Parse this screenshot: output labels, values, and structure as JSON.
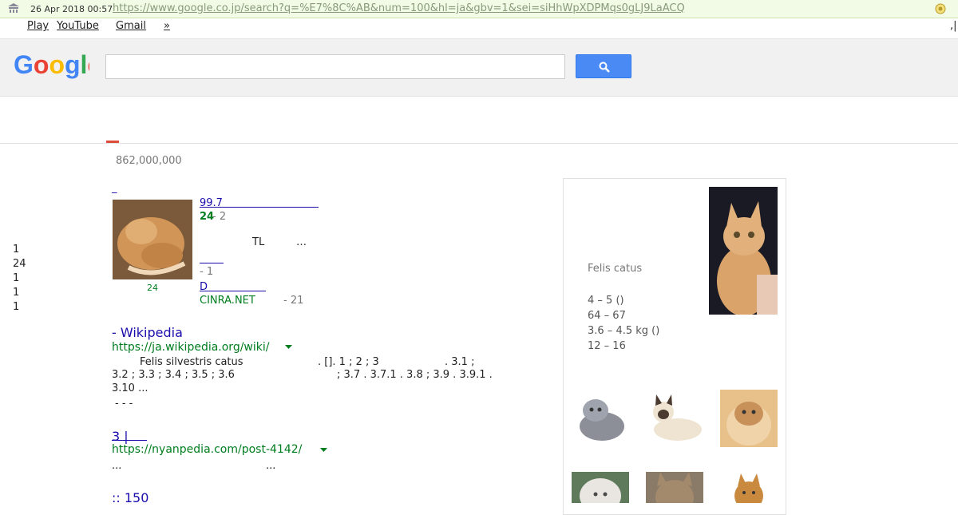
{
  "archive": {
    "date": "26 Apr 2018 00:57",
    "url": "https://www.google.co.jp/search?q=%E7%8C%AB&num=100&hl=ja&gbv=1&sei=siHhWpXDPMqs0gLJ9LaACQ",
    "right_mark": ",|"
  },
  "nav": {
    "play": "Play",
    "youtube": "YouTube",
    "gmail": "Gmail",
    "more": "»"
  },
  "search": {
    "query": "",
    "placeholder": ""
  },
  "colors": {
    "google_blue": "#4285f4",
    "google_red": "#ea4335",
    "google_yellow": "#fbbc05",
    "google_green": "#34a853",
    "url_green": "#007d1f",
    "link": "#1a0dab",
    "button_blue": "#4a8af4"
  },
  "results_count": "862,000,000",
  "left_facts": [
    "1",
    "24",
    "1",
    "1",
    "1"
  ],
  "news": {
    "heading": "_",
    "thumb_caption": "24",
    "item1_title": "99.7",
    "item1_meta_source": "24",
    "item1_meta_time": " - 2",
    "snippet_tl": "TL",
    "snippet_ellipsis": "…",
    "item2_title": "",
    "item2_time": " - 1",
    "item3_title": "D",
    "item3_source": "CINRA.NET",
    "item3_time": "- 21"
  },
  "results": [
    {
      "title": " - Wikipedia",
      "url": "https://ja.wikipedia.org/wiki/",
      "line1a": "Felis silvestris catus",
      "line1b": ". []. 1 ; 2 ; 3",
      "line1c": ". 3.1 ;",
      "line2a": "3.2 ; 3.3 ; 3.4 ; 3.5 ; 3.6",
      "line2b": "; 3.7 . 3.7.1 . 3.8 ; 3.9 . 3.9.1 .",
      "line3": "3.10  ...",
      "sitelinks": "-  -  -"
    },
    {
      "title": "3 |",
      "url": "https://nyanpedia.com/post-4142/",
      "snip_a": "...",
      "snip_b": "..."
    },
    {
      "title": ":: 150"
    }
  ],
  "knowledge_panel": {
    "scientific_name": "Felis catus",
    "facts": [
      "4 – 5 ()",
      "64 – 67",
      "3.6 – 4.5 kg ()",
      "12 – 16"
    ]
  }
}
